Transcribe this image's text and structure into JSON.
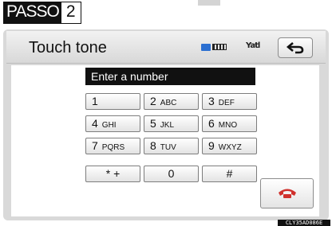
{
  "step": {
    "label": "PASSO",
    "number": "2"
  },
  "screen": {
    "title": "Touch tone",
    "status": {
      "bluetooth": "bluetooth-icon",
      "battery": "battery-icon",
      "signal": "signal-icon",
      "signal_text": "Yatl"
    }
  },
  "number_field": {
    "placeholder": "Enter a number"
  },
  "keypad": [
    {
      "digit": "1",
      "letters": ""
    },
    {
      "digit": "2",
      "letters": "ABC"
    },
    {
      "digit": "3",
      "letters": "DEF"
    },
    {
      "digit": "4",
      "letters": "GHI"
    },
    {
      "digit": "5",
      "letters": "JKL"
    },
    {
      "digit": "6",
      "letters": "MNO"
    },
    {
      "digit": "7",
      "letters": "PQRS"
    },
    {
      "digit": "8",
      "letters": "TUV"
    },
    {
      "digit": "9",
      "letters": "WXYZ"
    },
    {
      "digit": "* +",
      "letters": ""
    },
    {
      "digit": "0",
      "letters": ""
    },
    {
      "digit": "#",
      "letters": ""
    }
  ],
  "ref_code": "CLY35AD086E",
  "colors": {
    "call_icon": "#d0312d",
    "field_bg": "#111111",
    "frame": "#d9d9d9"
  }
}
